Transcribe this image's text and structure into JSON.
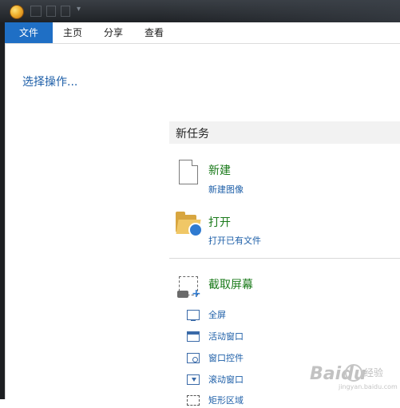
{
  "menu": {
    "tabs": [
      "文件",
      "主页",
      "分享",
      "查看"
    ]
  },
  "left": {
    "select_action": "选择操作..."
  },
  "panel": {
    "title": "新任务",
    "new": {
      "title": "新建",
      "sub": "新建图像"
    },
    "open": {
      "title": "打开",
      "sub": "打开已有文件"
    },
    "capture": {
      "title": "截取屏幕",
      "items": [
        "全屏",
        "活动窗口",
        "窗口控件",
        "滚动窗口",
        "矩形区域"
      ]
    }
  },
  "watermark": {
    "logo": "Baidu",
    "text": "经验",
    "url": "jingyan.baidu.com"
  },
  "colors": {
    "accent": "#1f6fc5",
    "link": "#1e5fa8",
    "entry_title": "#1a7a1a"
  },
  "icons": {
    "new": "blank-document-icon",
    "open": "folder-open-icon",
    "capture": "camera-capture-icon"
  }
}
